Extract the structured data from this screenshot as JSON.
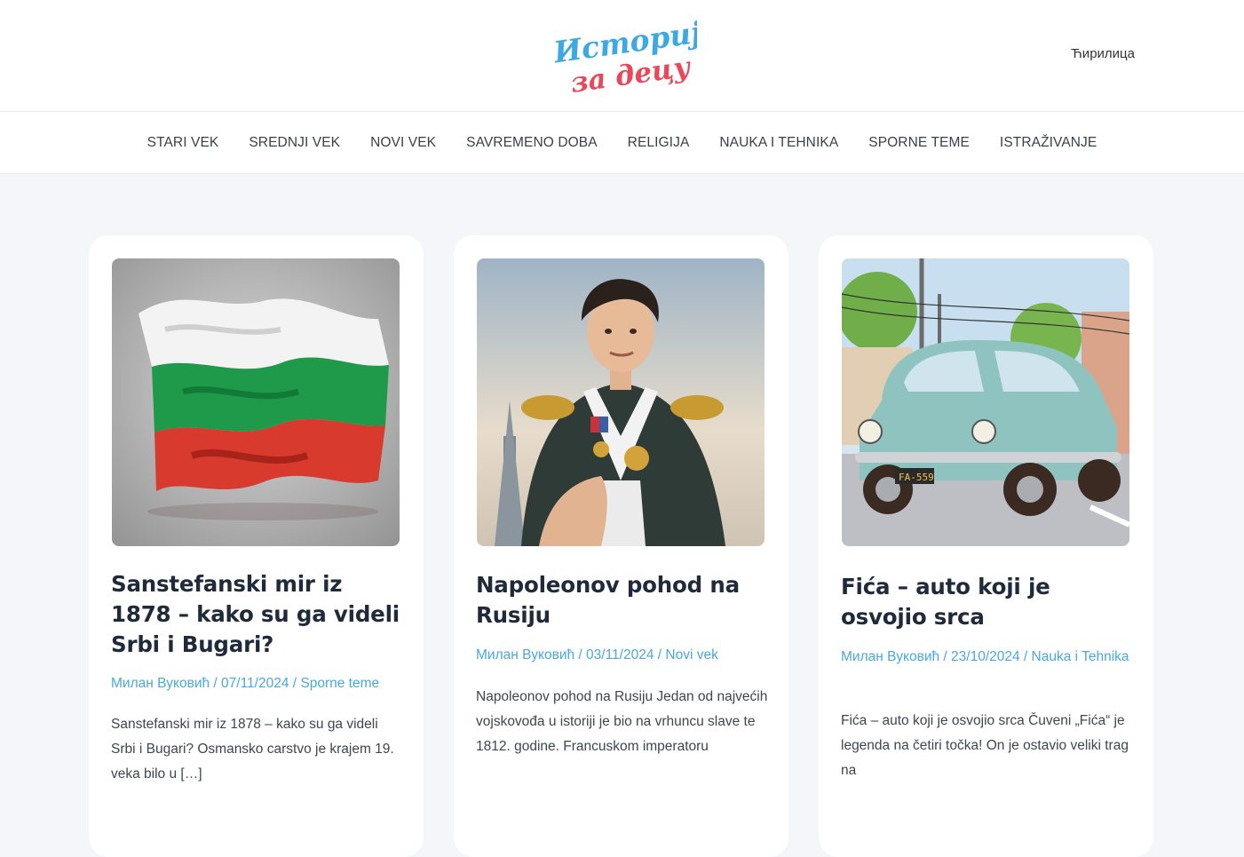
{
  "header": {
    "logo_line1": "Историја",
    "logo_line2": "за децу",
    "language_toggle": "Ћирилица"
  },
  "nav": {
    "items": [
      "STARI VEK",
      "SREDNJI VEK",
      "NOVI VEK",
      "SAVREMENO DOBA",
      "RELIGIJA",
      "NAUKA I TEHNIKA",
      "SPORNE TEME",
      "ISTRAŽIVANJE"
    ]
  },
  "posts": [
    {
      "title": "Sanstefanski mir iz 1878 – kako su ga videli Srbi i Bugari?",
      "author": "Милан Вуковић",
      "date": "07/11/2024",
      "category": "Sporne teme",
      "excerpt": "Sanstefanski mir iz 1878 – kako su ga videli Srbi i Bugari? Osmansko carstvo je krajem 19. veka bilo u […]",
      "image": "bulgarian-flag-image"
    },
    {
      "title": "Napoleonov pohod na Rusiju",
      "author": "Милан Вуковић",
      "date": "03/11/2024",
      "category": "Novi vek",
      "excerpt": "Napoleonov pohod na Rusiju Jedan od najvećih vojskovođa u istoriji je bio na vrhuncu slave te 1812. godine. Francuskom imperatoru",
      "image": "napoleon-portrait-image"
    },
    {
      "title": "Fića – auto koji je osvojio srca",
      "author": "Милан Вуковић",
      "date": "23/10/2024",
      "category": "Nauka i Tehnika",
      "excerpt": "Fića – auto koji je osvojio srca Čuveni „Fića“ je legenda na četiri točka! On je ostavio veliki trag na",
      "image": "fica-car-image",
      "plate": "FA-559"
    }
  ],
  "separator": " / ",
  "colors": {
    "logo_blue": "#3da9e3",
    "logo_red": "#e8485a",
    "meta_link": "#4aa8dc",
    "title": "#1f2a3a",
    "page_bg": "#f4f6f9"
  }
}
